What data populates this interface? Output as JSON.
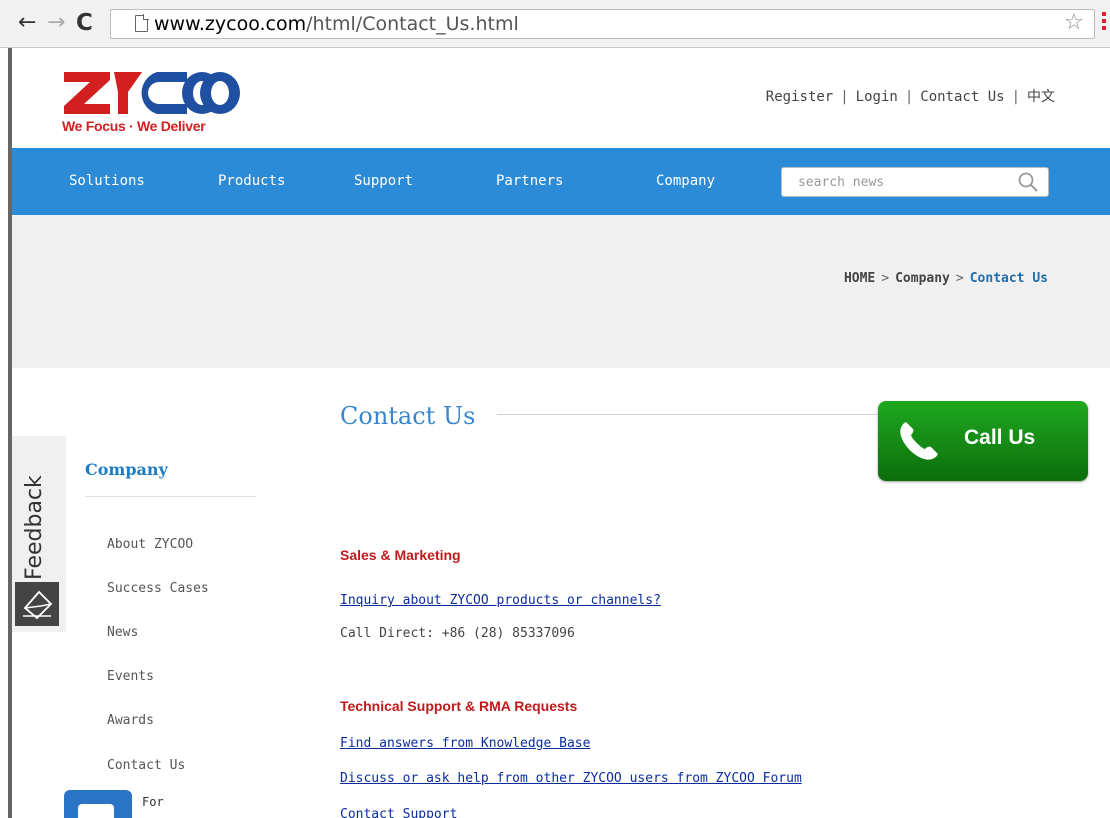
{
  "browser": {
    "url_host": "www.zycoo.com",
    "url_path": "/html/Contact_Us.html"
  },
  "header": {
    "logo_tagline": "We Focus · We Deliver",
    "links": [
      "Register",
      "Login",
      "Contact Us",
      "中文"
    ]
  },
  "nav": {
    "items": [
      "Solutions",
      "Products",
      "Support",
      "Partners",
      "Company"
    ],
    "search_placeholder": "search news"
  },
  "breadcrumb": {
    "home": "HOME",
    "section": "Company",
    "current": "Contact Us"
  },
  "feedback": {
    "label": "Feedback"
  },
  "sidebar": {
    "title": "Company",
    "items": [
      "About ZYCOO",
      "Success Cases",
      "News",
      "Events",
      "Awards",
      "Contact Us"
    ],
    "widget_label": "For"
  },
  "content": {
    "title": "Contact Us",
    "sales_heading": "Sales & Marketing",
    "sales_link": "Inquiry about ZYCOO products or channels?",
    "sales_phone": "Call Direct: +86 (28) 85337096",
    "support_heading": "Technical Support & RMA Requests",
    "support_links": [
      "Find answers from  Knowledge Base",
      "Discuss or ask help from other ZYCOO users from ZYCOO Forum",
      "Contact Support"
    ]
  },
  "call_us": {
    "label": "Call Us",
    "color": "#139213"
  }
}
